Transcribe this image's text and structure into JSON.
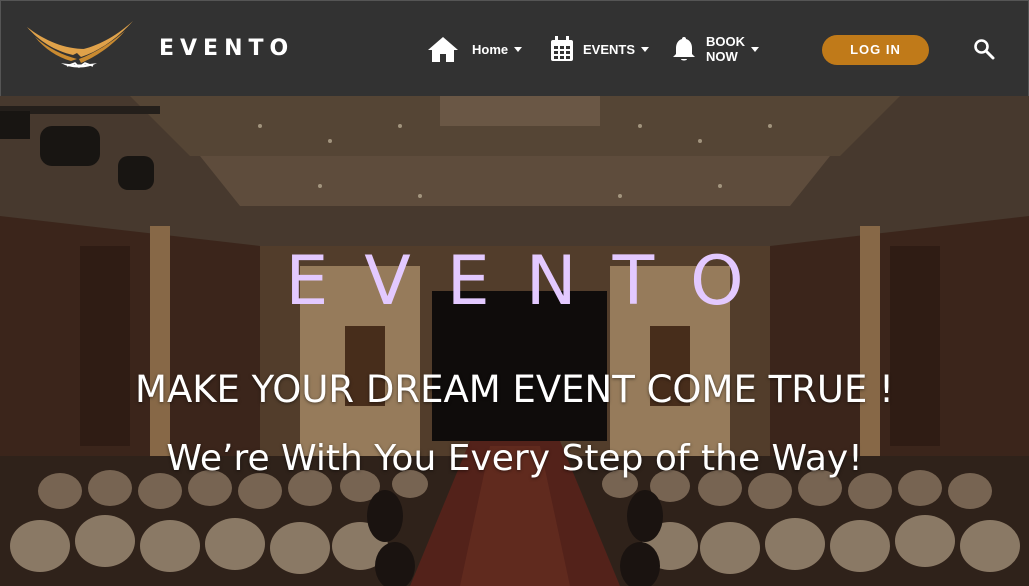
{
  "header": {
    "brand": "EVENTO",
    "logo_icon": "eagle-wings-logo",
    "nav": [
      {
        "label": "Home",
        "icon": "home-icon"
      },
      {
        "label": "EVENTS",
        "icon": "calendar-icon"
      },
      {
        "label": "BOOK NOW",
        "icon": "bell-icon"
      }
    ],
    "login_label": "LOG IN",
    "search_icon": "search-icon"
  },
  "hero": {
    "title": "EVENTO",
    "tagline": "MAKE YOUR DREAM EVENT COME TRUE !",
    "subtitle": "We’re With You Every Step of the Way!"
  },
  "colors": {
    "header_bg": "#323232",
    "accent": "#c07a19",
    "hero_title": "#e3c9ff",
    "logo": "#e0a24a"
  }
}
